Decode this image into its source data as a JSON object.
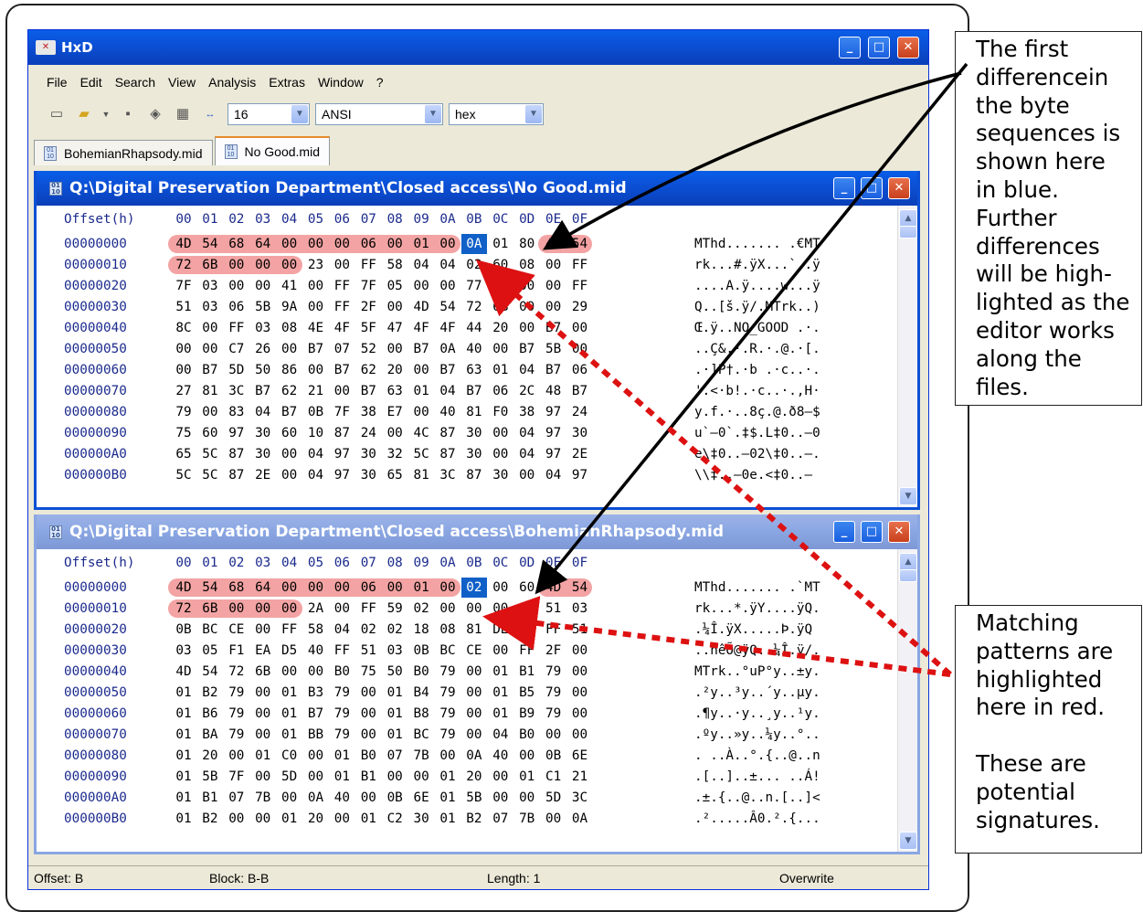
{
  "window": {
    "title": "HxD"
  },
  "menu": [
    "File",
    "Edit",
    "Search",
    "View",
    "Analysis",
    "Extras",
    "Window",
    "?"
  ],
  "toolbar": {
    "bytes_per_row": "16",
    "charset": "ANSI",
    "display": "hex"
  },
  "tabs": [
    {
      "label": "BohemianRhapsody.mid",
      "active": false
    },
    {
      "label": "No Good.mid",
      "active": true
    }
  ],
  "header": {
    "offset": "Offset(h)",
    "cols": [
      "00",
      "01",
      "02",
      "03",
      "04",
      "05",
      "06",
      "07",
      "08",
      "09",
      "0A",
      "0B",
      "0C",
      "0D",
      "0E",
      "0F"
    ]
  },
  "panes": [
    {
      "title": "Q:\\Digital Preservation Department\\Closed access\\No Good.mid",
      "active": true,
      "rows": [
        {
          "off": "00000000",
          "hex": "4D 54 68 64 00 00 00 06 00 01 00 0A 01 80 4D 54",
          "text": "MThd....... .€MT"
        },
        {
          "off": "00000010",
          "hex": "72 6B 00 00 00 23 00 FF 58 04 04 02 60 08 00 FF",
          "text": "rk...#.ÿX...`..ÿ"
        },
        {
          "off": "00000020",
          "hex": "7F 03 00 00 41 00 FF 7F 05 00 00 77 0E 00 00 FF",
          "text": "....A.ÿ....w...ÿ"
        },
        {
          "off": "00000030",
          "hex": "51 03 06 5B 9A 00 FF 2F 00 4D 54 72 6B 00 00 29",
          "text": "Q..[š.ÿ/.MTrk..)"
        },
        {
          "off": "00000040",
          "hex": "8C 00 FF 03 08 4E 4F 5F 47 4F 4F 44 20 00 B7 00",
          "text": "Œ.ÿ..NO_GOOD .·."
        },
        {
          "off": "00000050",
          "hex": "00 00 C7 26 00 B7 07 52 00 B7 0A 40 00 B7 5B 00",
          "text": "..Ç&.·.R.·.@.·[."
        },
        {
          "off": "00000060",
          "hex": "00 B7 5D 50 86 00 B7 62 20 00 B7 63 01 04 B7 06",
          "text": ".·]P†.·b .·c..·."
        },
        {
          "off": "00000070",
          "hex": "27 81 3C B7 62 21 00 B7 63 01 04 B7 06 2C 48 B7",
          "text": "'.<·b!.·c..·.,H·"
        },
        {
          "off": "00000080",
          "hex": "79 00 83 04 B7 0B 7F 38 E7 00 40 81 F0 38 97 24",
          "text": "y.f.·..8ç.@.ð8—$"
        },
        {
          "off": "00000090",
          "hex": "75 60 97 30 60 10 87 24 00 4C 87 30 00 04 97 30",
          "text": "u`—0`.‡$.L‡0..—0"
        },
        {
          "off": "000000A0",
          "hex": "65 5C 87 30 00 04 97 30 32 5C 87 30 00 04 97 2E",
          "text": "e\\‡0..—02\\‡0..—."
        },
        {
          "off": "000000B0",
          "hex": "5C 5C 87 2E 00 04 97 30 65 81 3C 87 30 00 04 97",
          "text": "\\\\‡..—0e.<‡0..—"
        }
      ]
    },
    {
      "title": "Q:\\Digital Preservation Department\\Closed access\\BohemianRhapsody.mid",
      "active": false,
      "rows": [
        {
          "off": "00000000",
          "hex": "4D 54 68 64 00 00 00 06 00 01 00 02 00 60 4D 54",
          "text": "MThd....... .`MT"
        },
        {
          "off": "00000010",
          "hex": "72 6B 00 00 00 2A 00 FF 59 02 00 00 00 FF 51 03",
          "text": "rk...*.ÿY....ÿQ."
        },
        {
          "off": "00000020",
          "hex": "0B BC CE 00 FF 58 04 02 02 18 08 81 DE 00 FF 51",
          "text": ".¼Î.ÿX.....Þ.ÿQ"
        },
        {
          "off": "00000030",
          "hex": "03 05 F1 EA D5 40 FF 51 03 0B BC CE 00 FF 2F 00",
          "text": "..ñêÕ@ÿQ..¼Î.ÿ/."
        },
        {
          "off": "00000040",
          "hex": "4D 54 72 6B 00 00 B0 75 50 B0 79 00 01 B1 79 00",
          "text": "MTrk..°uP°y..±y."
        },
        {
          "off": "00000050",
          "hex": "01 B2 79 00 01 B3 79 00 01 B4 79 00 01 B5 79 00",
          "text": ".²y..³y..´y..µy."
        },
        {
          "off": "00000060",
          "hex": "01 B6 79 00 01 B7 79 00 01 B8 79 00 01 B9 79 00",
          "text": ".¶y..·y..¸y..¹y."
        },
        {
          "off": "00000070",
          "hex": "01 BA 79 00 01 BB 79 00 01 BC 79 00 04 B0 00 00",
          "text": ".ºy..»y..¼y..°.."
        },
        {
          "off": "00000080",
          "hex": "01 20 00 01 C0 00 01 B0 07 7B 00 0A 40 00 0B 6E",
          "text": ". ..À..°.{..@..n"
        },
        {
          "off": "00000090",
          "hex": "01 5B 7F 00 5D 00 01 B1 00 00 01 20 00 01 C1 21",
          "text": ".[..]..±... ..Á!"
        },
        {
          "off": "000000A0",
          "hex": "01 B1 07 7B 00 0A 40 00 0B 6E 01 5B 00 00 5D 3C",
          "text": ".±.{..@..n.[..]<"
        },
        {
          "off": "000000B0",
          "hex": "01 B2 00 00 01 20 00 01 C2 30 01 B2 07 7B 00 0A",
          "text": ".².....Â0.².{..."
        }
      ]
    }
  ],
  "status": {
    "offset": "Offset: B",
    "block": "Block: B-B",
    "length": "Length: 1",
    "mode": "Overwrite"
  },
  "notes": {
    "first": [
      "The first",
      "differencein",
      "the byte",
      "sequences is",
      "shown here",
      "in blue.",
      "Further",
      "differences",
      "will be high-",
      "lighted as the",
      "editor works",
      "along the",
      "files."
    ],
    "second": [
      "Matching",
      "patterns are",
      "highlighted",
      "here in red.",
      "",
      "These are",
      "potential",
      "signatures."
    ]
  },
  "colors": {
    "match": "#f3a3a3",
    "diff": "#1060c8",
    "annotation_arrow": "#000000",
    "pattern_arrow": "#dd1111"
  }
}
